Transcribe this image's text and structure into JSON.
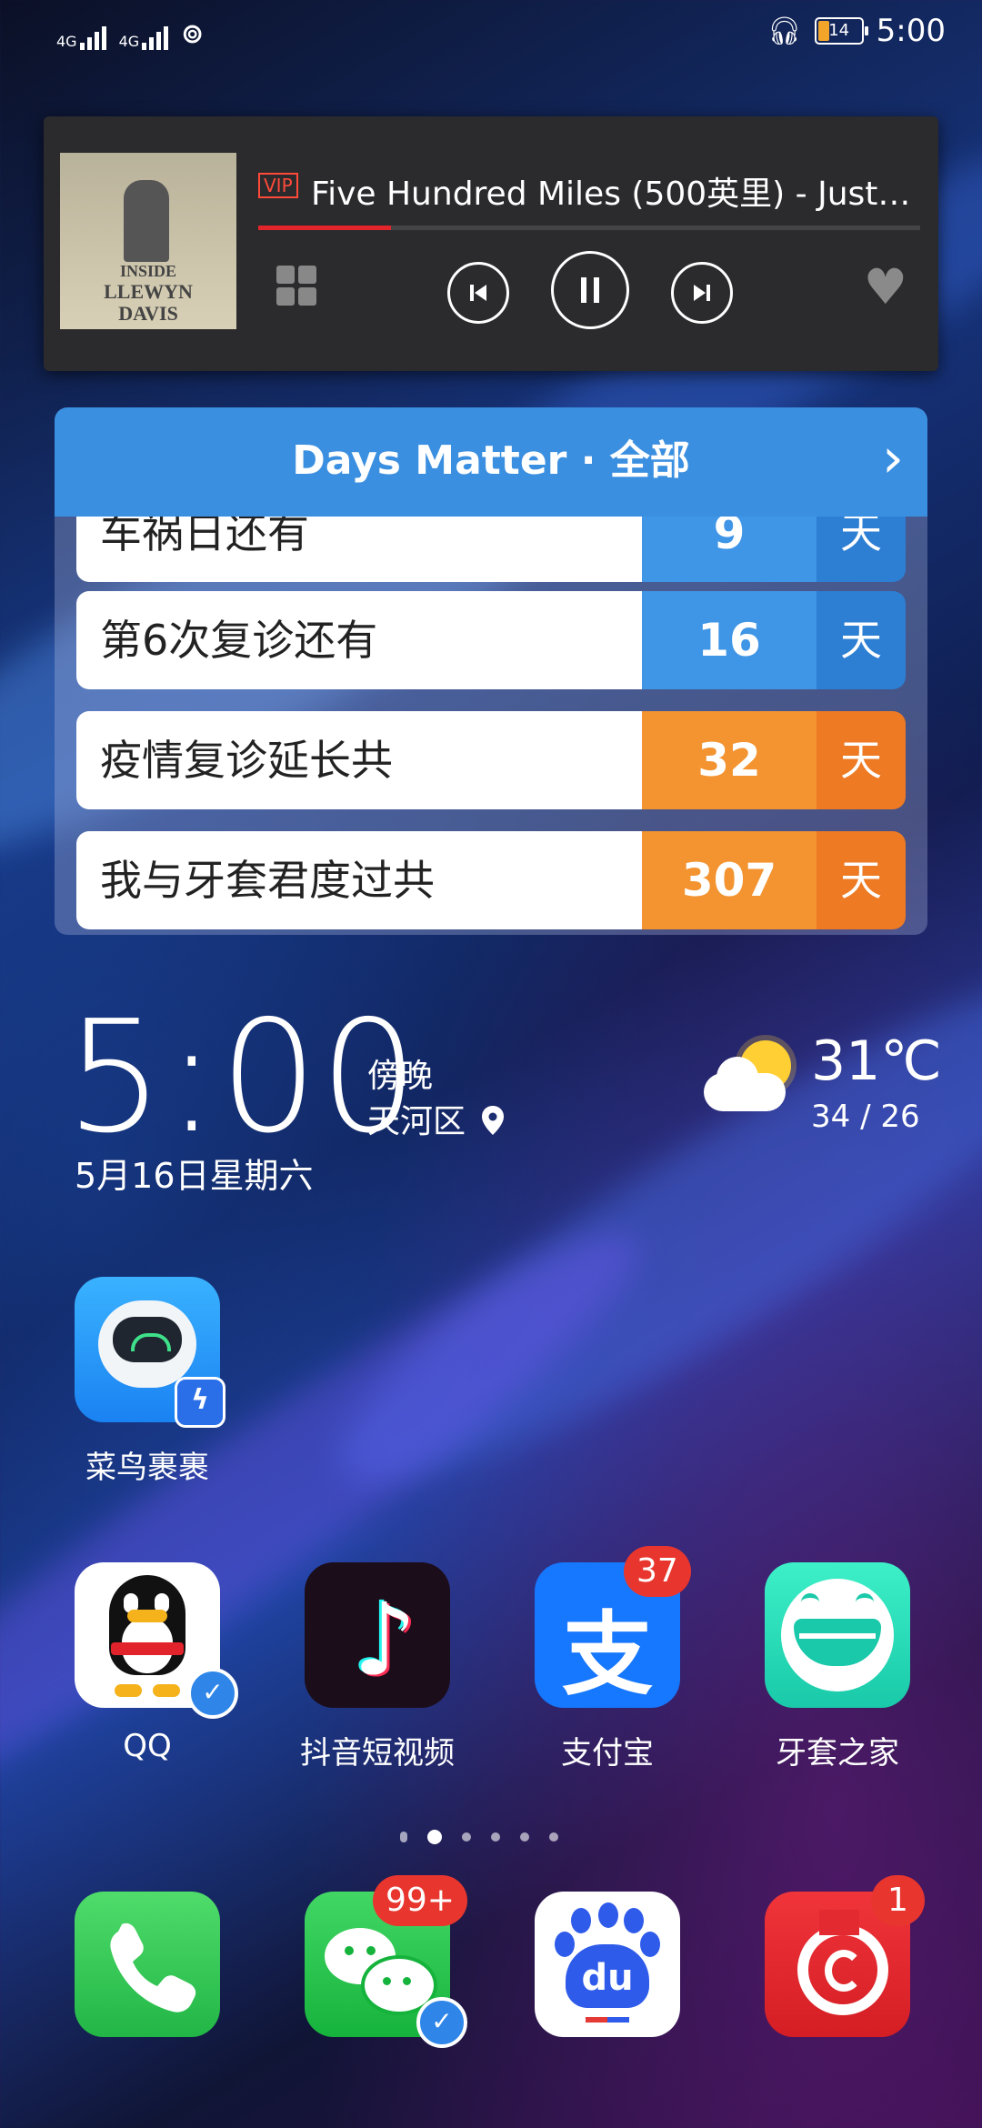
{
  "status_bar": {
    "net1": "4G",
    "net2": "4G",
    "battery": "14",
    "time": "5:00"
  },
  "music_widget": {
    "vip": "VIP",
    "song_title": "Five Hundred Miles (500英里) - Just…",
    "progress_fraction": 0.2,
    "album_line1": "INSIDE",
    "album_line2": "LLEWYN",
    "album_line3": "DAVIS"
  },
  "days_matter": {
    "title": "Days Matter · 全部",
    "rows": [
      {
        "label": "车祸日还有",
        "number": "9",
        "unit": "天",
        "color": "blue"
      },
      {
        "label": "第6次复诊还有",
        "number": "16",
        "unit": "天",
        "color": "blue"
      },
      {
        "label": "疫情复诊延长共",
        "number": "32",
        "unit": "天",
        "color": "orange"
      },
      {
        "label": "我与牙套君度过共",
        "number": "307",
        "unit": "天",
        "color": "orange"
      }
    ]
  },
  "clock_widget": {
    "time": "5:00",
    "period": "傍晚",
    "district": "天河区",
    "date": "5月16日星期六",
    "temperature": "31℃",
    "temp_range": "34 / 26"
  },
  "apps": {
    "cainiao": "菜鸟裹裹",
    "qq": "QQ",
    "douyin": "抖音短视频",
    "alipay": "支付宝",
    "alipay_badge": "37",
    "yatao": "牙套之家",
    "wechat_badge": "99+",
    "netease_badge": "1"
  },
  "colors": {
    "blue": "#3f95e6",
    "blue_dark": "#2d7fd4",
    "orange": "#f39431",
    "orange_dark": "#ee7a23"
  }
}
